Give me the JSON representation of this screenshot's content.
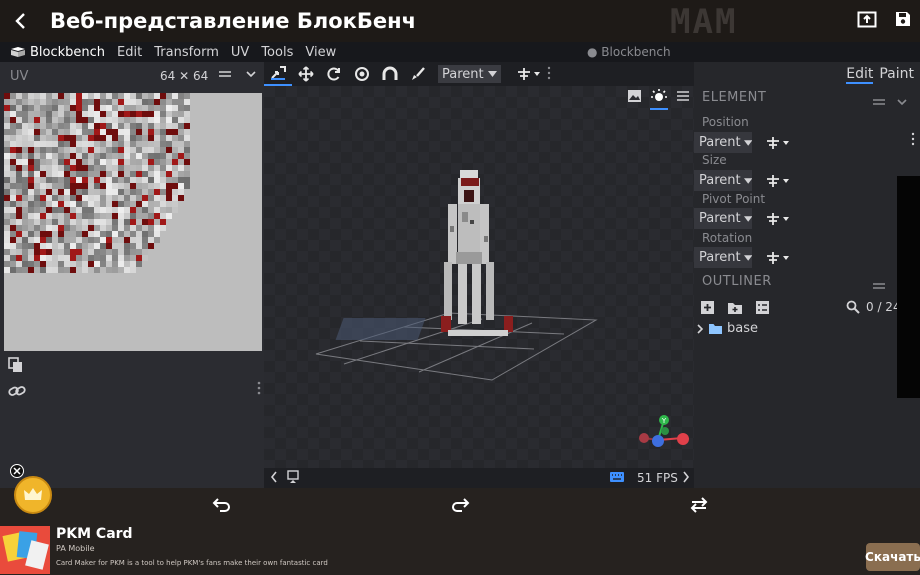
{
  "appbar": {
    "title": "Веб-представление БлокБенч",
    "logo_text": "MAM",
    "icons": [
      "back-arrow-icon",
      "share-icon",
      "save-icon"
    ]
  },
  "menubar": {
    "logo": "Blockbench",
    "items": [
      "Edit",
      "Transform",
      "UV",
      "Tools",
      "View"
    ],
    "window_title": "Blockbench"
  },
  "uv_panel": {
    "title": "UV",
    "size": "64 ✕ 64"
  },
  "toolbar": {
    "tools": [
      "move-pan-icon",
      "move-icon",
      "rotate-icon",
      "pivot-icon",
      "vertex-snap-icon",
      "paint-brush-icon"
    ],
    "transform_space": "Parent"
  },
  "viewport": {
    "fps": "51 FPS"
  },
  "right_panel": {
    "modes": [
      "Edit",
      "Paint"
    ],
    "element": {
      "heading": "ELEMENT",
      "properties": [
        {
          "label": "Position",
          "space": "Parent"
        },
        {
          "label": "Size",
          "space": "Parent"
        },
        {
          "label": "Pivot Point",
          "space": "Parent"
        },
        {
          "label": "Rotation",
          "space": "Parent"
        }
      ]
    },
    "outliner": {
      "heading": "OUTLINER",
      "count": "0 / 24",
      "tree": [
        {
          "name": "base",
          "type": "folder"
        }
      ]
    }
  },
  "ad": {
    "title": "PKM Card",
    "publisher": "PA Mobile",
    "description": "Card Maker for PKM is a tool to help PKM's fans make their own fantastic card",
    "cta": "Скачать"
  },
  "colors": {
    "accent": "#3e90ff",
    "panel": "#2b2c31",
    "ad_button": "#8a6e50"
  }
}
